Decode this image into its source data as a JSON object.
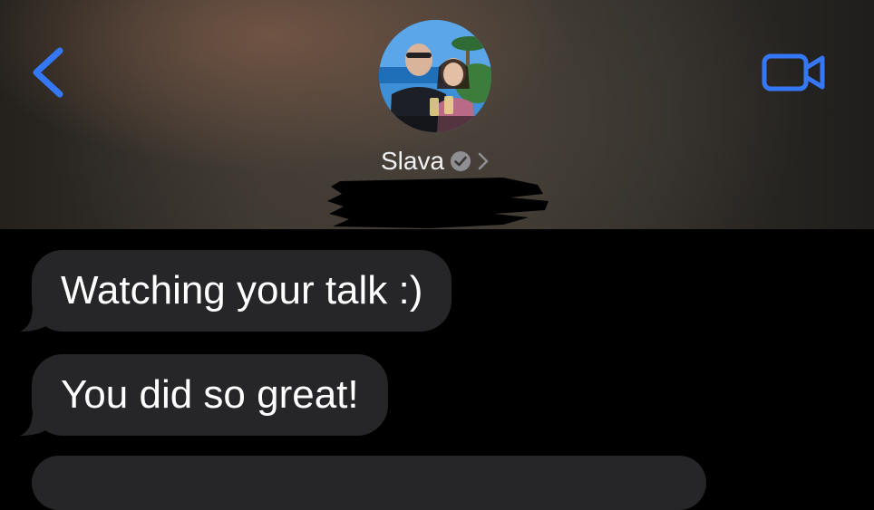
{
  "header": {
    "back_icon": "chevron-left-icon",
    "video_icon": "video-camera-icon",
    "contact": {
      "name": "Slava",
      "verified_icon": "checkmark-badge-icon",
      "disclosure_icon": "chevron-right-icon"
    },
    "accent_color": "#3478F6"
  },
  "messages": [
    {
      "text": "Watching your talk :)"
    },
    {
      "text": "You did so great!"
    },
    {
      "text": ""
    }
  ],
  "colors": {
    "incoming_bubble": "#262628",
    "background": "#000000"
  }
}
